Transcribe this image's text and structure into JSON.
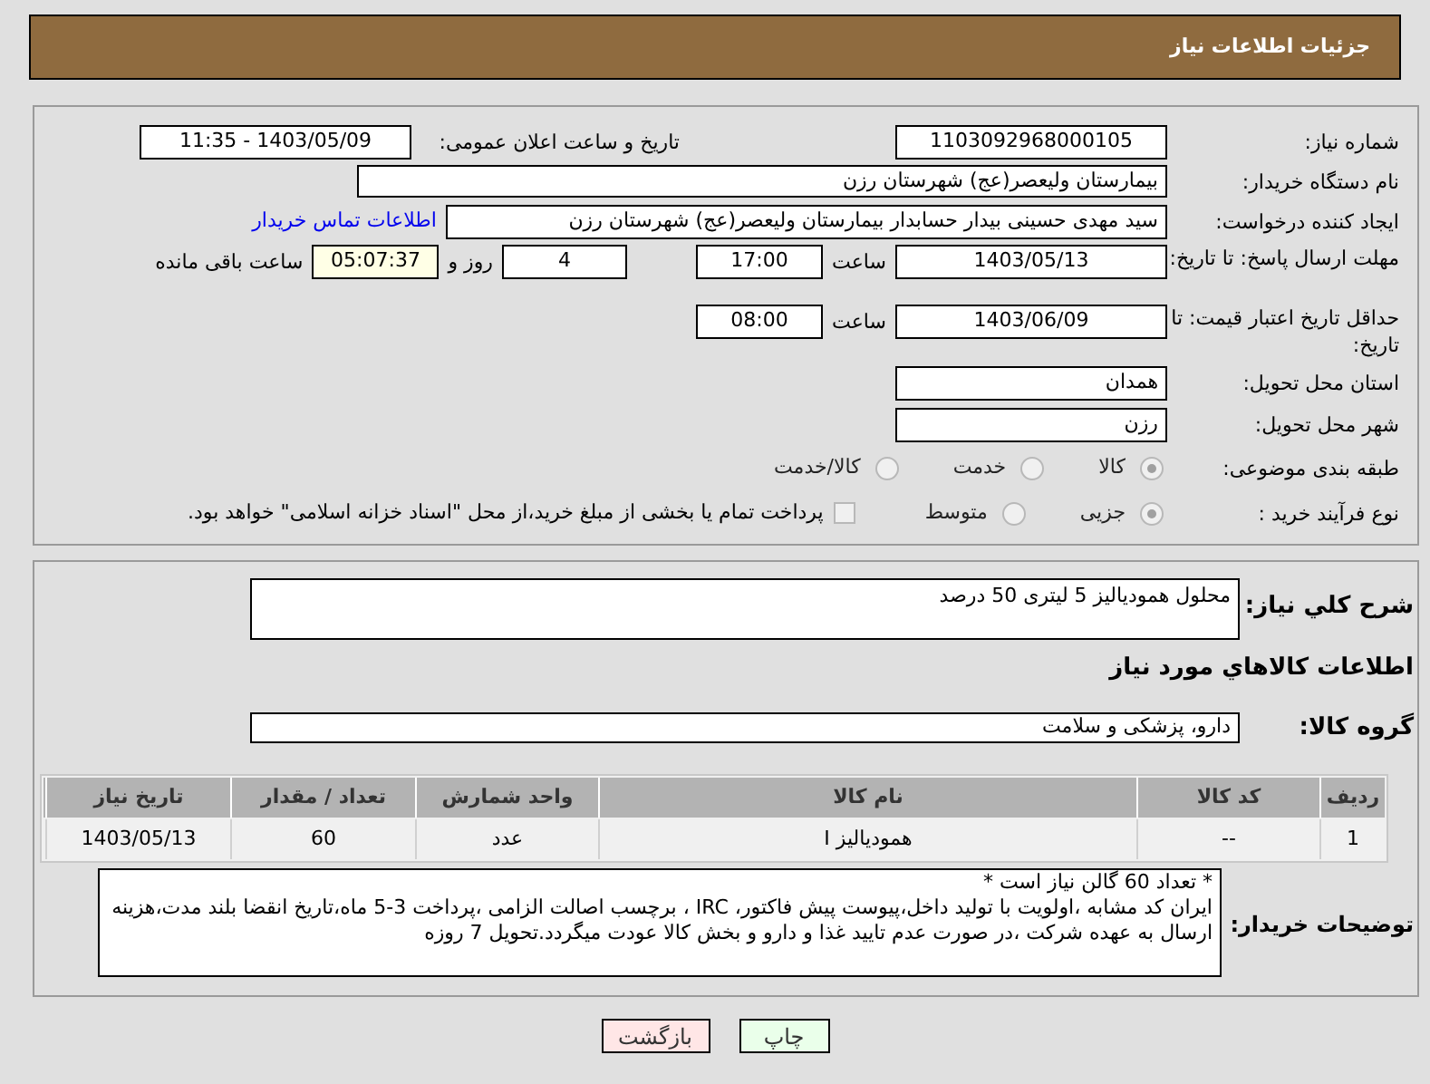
{
  "header": {
    "title": "جزئیات اطلاعات نیاز"
  },
  "need_number": {
    "label": "شماره نیاز:",
    "value": "1103092968000105"
  },
  "announce": {
    "label": "تاریخ و ساعت اعلان عمومی:",
    "value": "1403/05/09 - 11:35"
  },
  "buyer_org": {
    "label": "نام دستگاه خریدار:",
    "value": "بیمارستان ولیعصر(عج) شهرستان رزن"
  },
  "requester": {
    "label": "ایجاد کننده درخواست:",
    "value": "سید مهدی حسینی بیدار حسابدار بیمارستان ولیعصر(عج) شهرستان رزن",
    "link": "اطلاعات تماس خریدار"
  },
  "reply_deadline": {
    "label": "مهلت ارسال پاسخ: تا تاریخ:",
    "date": "1403/05/13",
    "time_label": "ساعت",
    "time": "17:00",
    "days": "4",
    "days_label": "روز و",
    "remaining": "05:07:37",
    "remaining_label": "ساعت باقی مانده"
  },
  "price_validity": {
    "label": "حداقل تاریخ اعتبار قیمت: تا تاریخ:",
    "date": "1403/06/09",
    "time_label": "ساعت",
    "time": "08:00"
  },
  "province": {
    "label": "استان محل تحویل:",
    "value": "همدان"
  },
  "city": {
    "label": "شهر محل تحویل:",
    "value": "رزن"
  },
  "category": {
    "label": "طبقه بندی موضوعی:",
    "options": [
      {
        "label": "کالا",
        "selected": true
      },
      {
        "label": "خدمت",
        "selected": false
      },
      {
        "label": "کالا/خدمت",
        "selected": false
      }
    ]
  },
  "purchase_type": {
    "label": "نوع فرآیند خرید :",
    "options": [
      {
        "label": "جزیی",
        "selected": true
      },
      {
        "label": "متوسط",
        "selected": false
      }
    ],
    "payment": {
      "label": "پرداخت تمام یا بخشی از مبلغ خرید،از محل \"اسناد خزانه اسلامی\" خواهد بود.",
      "checked": false
    }
  },
  "description": {
    "label": "شرح کلي نیاز:",
    "value": "محلول همودیالیز 5 لیتری 50 درصد"
  },
  "goods_title": "اطلاعات کالاهاي مورد نیاز",
  "goods_group": {
    "label": "گروه کالا:",
    "value": "دارو، پزشکی و سلامت"
  },
  "table": {
    "columns": [
      "ردیف",
      "کد کالا",
      "نام کالا",
      "واحد شمارش",
      "تعداد / مقدار",
      "تاریخ نیاز"
    ],
    "rows": [
      [
        "1",
        "--",
        "همودیالیز I",
        "عدد",
        "60",
        "1403/05/13"
      ]
    ]
  },
  "buyer_notes": {
    "label": "توضیحات خریدار:",
    "paragraphs": [
      "* تعداد 60 گالن نیاز است *",
      "ایران کد مشابه ،اولویت با تولید داخل،پیوست پیش فاکتور، IRC ، برچسب اصالت الزامی ،پرداخت 3-5 ماه،تاریخ انقضا بلند مدت،هزینه ارسال به عهده شرکت ،در صورت عدم تایید غذا و دارو و بخش کالا عودت میگردد.تحویل 7 روزه"
    ]
  },
  "buttons": [
    {
      "label": "چاپ",
      "kind": "print"
    },
    {
      "label": "بازگشت",
      "kind": "back"
    }
  ]
}
